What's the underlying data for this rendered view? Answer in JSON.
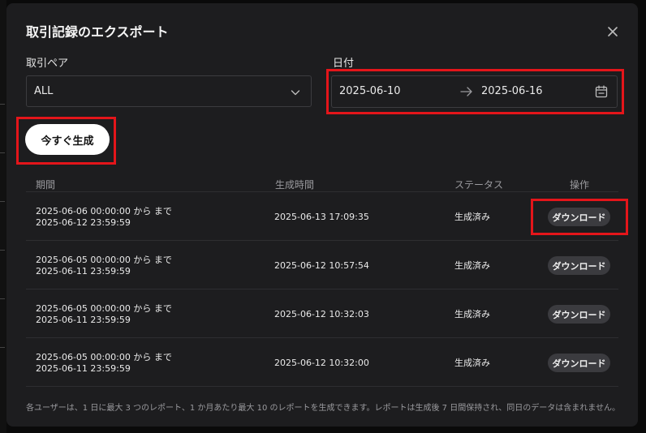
{
  "dialog": {
    "title": "取引記録のエクスポート"
  },
  "filters": {
    "pair_label": "取引ペア",
    "pair_value": "ALL",
    "date_label": "日付",
    "start_date": "2025-06-10",
    "end_date": "2025-06-16"
  },
  "actions": {
    "generate_label": "今すぐ生成"
  },
  "table": {
    "headers": {
      "period": "期間",
      "created": "生成時間",
      "status": "ステータス",
      "action": "操作"
    },
    "rows": [
      {
        "period_start": "2025-06-06 00:00:00 から まで",
        "period_end": "2025-06-12 23:59:59",
        "created": "2025-06-13 17:09:35",
        "status": "生成済み",
        "action": "ダウンロード"
      },
      {
        "period_start": "2025-06-05 00:00:00 から まで",
        "period_end": "2025-06-11 23:59:59",
        "created": "2025-06-12 10:57:54",
        "status": "生成済み",
        "action": "ダウンロード"
      },
      {
        "period_start": "2025-06-05 00:00:00 から まで",
        "period_end": "2025-06-11 23:59:59",
        "created": "2025-06-12 10:32:03",
        "status": "生成済み",
        "action": "ダウンロード"
      },
      {
        "period_start": "2025-06-05 00:00:00 から まで",
        "period_end": "2025-06-11 23:59:59",
        "created": "2025-06-12 10:32:00",
        "status": "生成済み",
        "action": "ダウンロード"
      }
    ]
  },
  "footnote": "各ユーザーは、1 日に最大 3 つのレポート、1 か月あたり最大 10 のレポートを生成できます。レポートは生成後 7 日間保持され、同日のデータは含まれません。",
  "icons": {
    "close": "close-icon",
    "dropdown": "chevron-down-icon",
    "arrow": "arrow-right-icon",
    "calendar": "calendar-icon"
  },
  "colors": {
    "highlight": "#e4151a",
    "dialog_bg": "#1d1d1f",
    "primary_button": "#ffffff",
    "pill_button": "#3b3b3f"
  }
}
